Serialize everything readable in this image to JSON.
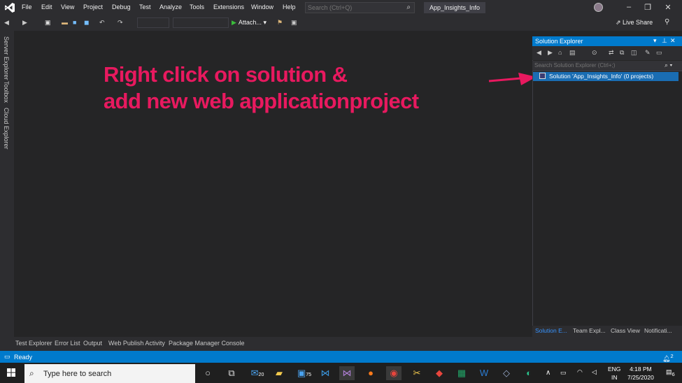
{
  "window": {
    "solution_title": "App_Insights_Info",
    "search_placeholder": "Search (Ctrl+Q)"
  },
  "menu": [
    "File",
    "Edit",
    "View",
    "Project",
    "Debug",
    "Test",
    "Analyze",
    "Tools",
    "Extensions",
    "Window",
    "Help"
  ],
  "toolbar": {
    "attach_label": "Attach...",
    "live_share_label": "Live Share"
  },
  "left_rail": [
    "Server Explorer",
    "Toolbox",
    "Cloud Explorer"
  ],
  "annotation": {
    "line1": "Right click on solution &",
    "line2": "add new web applicationproject",
    "color": "#e8195f"
  },
  "solution_explorer": {
    "title": "Solution Explorer",
    "search_placeholder": "Search Solution Explorer (Ctrl+;)",
    "tree_item": "Solution 'App_Insights_Info' (0 projects)",
    "bottom_tabs": [
      "Solution E...",
      "Team Expl...",
      "Class View",
      "Notificati..."
    ]
  },
  "bottom_tabs": [
    "Test Explorer",
    "Error List",
    "Output",
    "Web Publish Activity",
    "Package Manager Console"
  ],
  "status": {
    "text": "Ready",
    "notifications": "2",
    "accent": "#007acc"
  },
  "taskbar": {
    "search_placeholder": "Type here to search",
    "mail_badge": "20",
    "store_badge": "75",
    "lang_line1": "ENG",
    "lang_line2": "IN",
    "time": "4:18 PM",
    "date": "7/25/2020",
    "action_center_badge": "6"
  }
}
